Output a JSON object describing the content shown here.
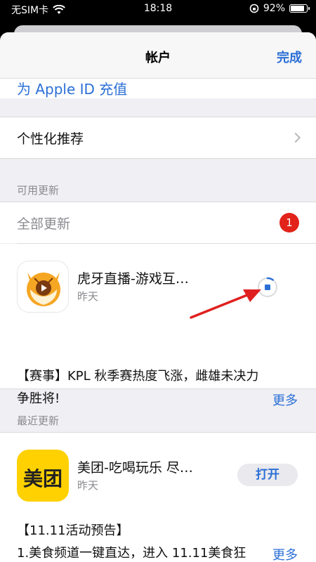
{
  "status_bar": {
    "carrier": "无SIM卡",
    "time": "18:18",
    "battery": "92%",
    "battery_level": 0.92
  },
  "nav": {
    "title": "帐户",
    "done": "完成"
  },
  "partial_row": {
    "label": "为 Apple ID 充值"
  },
  "personalize": {
    "label": "个性化推荐"
  },
  "available_updates": {
    "header": "可用更新",
    "update_all": "全部更新",
    "badge_count": "1",
    "apps": [
      {
        "name": "虎牙直播-游戏互…",
        "date": "昨天",
        "notes_line1": "【赛事】KPL 秋季赛热度飞涨，雌雄未决力",
        "notes_line2": "争胜将!",
        "more": "更多",
        "progress": 0.1
      }
    ]
  },
  "recent_updates": {
    "header": "最近更新",
    "apps": [
      {
        "name": "美团-吃喝玩乐 尽…",
        "date": "昨天",
        "icon_text": "美团",
        "open_label": "打开",
        "notes_line1": "【11.11活动预告】",
        "notes_line2": "1.美食频道一键直达，进入 11.11美食狂",
        "more": "更多"
      }
    ]
  },
  "colors": {
    "accent": "#2b6fd6",
    "badge": "#e2231a",
    "arrow": "#e02020",
    "meituan": "#ffd100",
    "huya": "#f5a623"
  }
}
